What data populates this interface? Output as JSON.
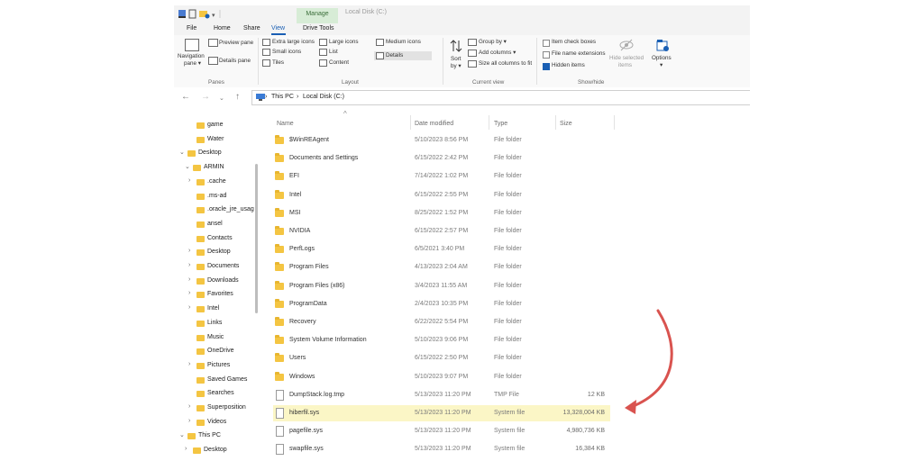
{
  "titlebar": {
    "manage_tab": "Manage",
    "window_title": "Local Disk (C:)"
  },
  "ribbon_tabs": [
    "File",
    "Home",
    "Share",
    "View",
    "Drive Tools"
  ],
  "ribbon": {
    "panes": {
      "navigation_pane": "Navigation",
      "navigation_pane2": "pane ▾",
      "preview_pane": "Preview pane",
      "details_pane": "Details pane",
      "group": "Panes"
    },
    "layout": {
      "extra_large": "Extra large icons",
      "large": "Large icons",
      "medium": "Medium icons",
      "small": "Small icons",
      "list": "List",
      "details": "Details",
      "tiles": "Tiles",
      "content": "Content",
      "group": "Layout"
    },
    "current_view": {
      "sort": "Sort",
      "sort2": "by ▾",
      "group_by": "Group by ▾",
      "add_columns": "Add columns ▾",
      "size_all": "Size all columns to fit",
      "group": "Current view"
    },
    "show_hide": {
      "item_checkboxes": "Item check boxes",
      "file_name_ext": "File name extensions",
      "hidden_items": "Hidden items",
      "hide_selected": "Hide selected",
      "hide_selected2": "items",
      "options": "Options",
      "options2": "▾",
      "group": "Show/hide"
    }
  },
  "address": {
    "this_pc": "This PC",
    "local_disk": "Local Disk (C:)"
  },
  "nav_tree": [
    {
      "label": "game",
      "indent": 2,
      "chev": ""
    },
    {
      "label": "Water",
      "indent": 2,
      "chev": ""
    },
    {
      "label": "Desktop",
      "indent": 0,
      "chev": "v"
    },
    {
      "label": "ARMIN",
      "indent": 1,
      "chev": "v"
    },
    {
      "label": ".cache",
      "indent": 2,
      "chev": ">"
    },
    {
      "label": ".ms-ad",
      "indent": 2,
      "chev": ""
    },
    {
      "label": ".oracle_jre_usag",
      "indent": 2,
      "chev": ""
    },
    {
      "label": "ansel",
      "indent": 2,
      "chev": ""
    },
    {
      "label": "Contacts",
      "indent": 2,
      "chev": ""
    },
    {
      "label": "Desktop",
      "indent": 2,
      "chev": ">"
    },
    {
      "label": "Documents",
      "indent": 2,
      "chev": ">"
    },
    {
      "label": "Downloads",
      "indent": 2,
      "chev": ">"
    },
    {
      "label": "Favorites",
      "indent": 2,
      "chev": ">"
    },
    {
      "label": "Intel",
      "indent": 2,
      "chev": ">"
    },
    {
      "label": "Links",
      "indent": 2,
      "chev": ""
    },
    {
      "label": "Music",
      "indent": 2,
      "chev": ""
    },
    {
      "label": "OneDrive",
      "indent": 2,
      "chev": ""
    },
    {
      "label": "Pictures",
      "indent": 2,
      "chev": ">"
    },
    {
      "label": "Saved Games",
      "indent": 2,
      "chev": ""
    },
    {
      "label": "Searches",
      "indent": 2,
      "chev": ""
    },
    {
      "label": "Superposition",
      "indent": 2,
      "chev": ">"
    },
    {
      "label": "Videos",
      "indent": 2,
      "chev": ">"
    },
    {
      "label": "This PC",
      "indent": 0,
      "chev": "v"
    },
    {
      "label": "Desktop",
      "indent": 1,
      "chev": ">"
    }
  ],
  "columns": {
    "name": "Name",
    "date": "Date modified",
    "type": "Type",
    "size": "Size"
  },
  "files": [
    {
      "name": "$WinREAgent",
      "date": "5/10/2023 8:56 PM",
      "type": "File folder",
      "size": "",
      "kind": "folder"
    },
    {
      "name": "Documents and Settings",
      "date": "6/15/2022 2:42 PM",
      "type": "File folder",
      "size": "",
      "kind": "folder"
    },
    {
      "name": "EFI",
      "date": "7/14/2022 1:02 PM",
      "type": "File folder",
      "size": "",
      "kind": "folder"
    },
    {
      "name": "Intel",
      "date": "6/15/2022 2:55 PM",
      "type": "File folder",
      "size": "",
      "kind": "folder"
    },
    {
      "name": "MSI",
      "date": "8/25/2022 1:52 PM",
      "type": "File folder",
      "size": "",
      "kind": "folder"
    },
    {
      "name": "NVIDIA",
      "date": "6/15/2022 2:57 PM",
      "type": "File folder",
      "size": "",
      "kind": "folder"
    },
    {
      "name": "PerfLogs",
      "date": "6/5/2021 3:40 PM",
      "type": "File folder",
      "size": "",
      "kind": "folder"
    },
    {
      "name": "Program Files",
      "date": "4/13/2023 2:04 AM",
      "type": "File folder",
      "size": "",
      "kind": "folder"
    },
    {
      "name": "Program Files (x86)",
      "date": "3/4/2023 11:55 AM",
      "type": "File folder",
      "size": "",
      "kind": "folder"
    },
    {
      "name": "ProgramData",
      "date": "2/4/2023 10:35 PM",
      "type": "File folder",
      "size": "",
      "kind": "folder"
    },
    {
      "name": "Recovery",
      "date": "6/22/2022 5:54 PM",
      "type": "File folder",
      "size": "",
      "kind": "folder"
    },
    {
      "name": "System Volume Information",
      "date": "5/10/2023 9:06 PM",
      "type": "File folder",
      "size": "",
      "kind": "folder"
    },
    {
      "name": "Users",
      "date": "6/15/2022 2:50 PM",
      "type": "File folder",
      "size": "",
      "kind": "folder"
    },
    {
      "name": "Windows",
      "date": "5/10/2023 9:07 PM",
      "type": "File folder",
      "size": "",
      "kind": "folder"
    },
    {
      "name": "DumpStack.log.tmp",
      "date": "5/13/2023 11:20 PM",
      "type": "TMP File",
      "size": "12 KB",
      "kind": "file"
    },
    {
      "name": "hiberfil.sys",
      "date": "5/13/2023 11:20 PM",
      "type": "System file",
      "size": "13,328,004 KB",
      "kind": "file",
      "highlighted": true
    },
    {
      "name": "pagefile.sys",
      "date": "5/13/2023 11:20 PM",
      "type": "System file",
      "size": "4,980,736 KB",
      "kind": "file"
    },
    {
      "name": "swapfile.sys",
      "date": "5/13/2023 11:20 PM",
      "type": "System file",
      "size": "16,384 KB",
      "kind": "file"
    }
  ],
  "colors": {
    "accent": "#1a5fb4",
    "highlight_row": "#fbf6c6",
    "folder": "#f4c542",
    "arrow": "#d9534f"
  }
}
